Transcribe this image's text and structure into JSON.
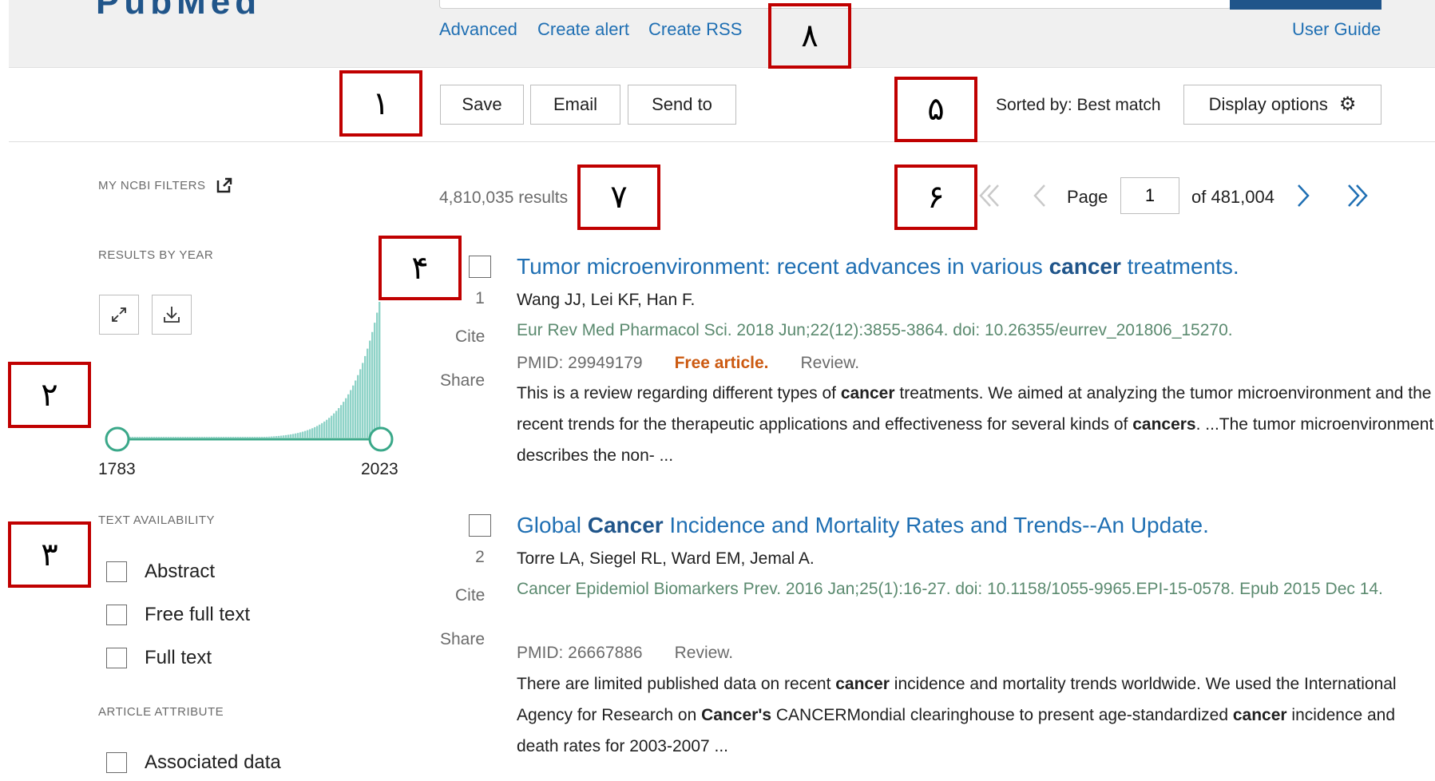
{
  "header": {
    "logo": "PubMed",
    "links": {
      "advanced": "Advanced",
      "create_alert": "Create alert",
      "create_rss": "Create RSS"
    },
    "user_guide": "User Guide"
  },
  "toolbar": {
    "save": "Save",
    "email": "Email",
    "send_to": "Send to",
    "sorted_by": "Sorted by: Best match",
    "display_options": "Display options"
  },
  "sidebar": {
    "my_ncbi_filters": "MY NCBI FILTERS",
    "results_by_year": "RESULTS BY YEAR",
    "year_start": "1783",
    "year_end": "2023",
    "text_availability": "TEXT AVAILABILITY",
    "text_filters": [
      "Abstract",
      "Free full text",
      "Full text"
    ],
    "article_attribute": "ARTICLE ATTRIBUTE",
    "attribute_filters": [
      "Associated data"
    ]
  },
  "histogram": {
    "color": "#8fd3c8",
    "slider_color": "#3aa889",
    "start_year": 1783,
    "end_year": 2023
  },
  "results_bar": {
    "count": "4,810,035 results",
    "page_label": "Page",
    "page_value": "1",
    "of_pages": "of 481,004"
  },
  "results": [
    {
      "number": "1",
      "cite": "Cite",
      "share": "Share",
      "title_parts": [
        "Tumor microenvironment: recent advances in various ",
        "cancer",
        " treatments."
      ],
      "authors": "Wang JJ, Lei KF, Han F.",
      "citation": "Eur Rev Med Pharmacol Sci. 2018 Jun;22(12):3855-3864. doi: 10.26355/eurrev_201806_15270.",
      "pmid": "PMID: 29949179",
      "free": "Free article.",
      "type": "Review.",
      "snippet_parts": [
        "This is a review regarding different types of ",
        "cancer",
        " treatments. We aimed at analyzing the tumor microenvironment and the recent trends for the therapeutic applications and effectiveness for several kinds of ",
        "cancers",
        ". ...The tumor microenvironment describes the non- ..."
      ]
    },
    {
      "number": "2",
      "cite": "Cite",
      "share": "Share",
      "title_parts": [
        "Global ",
        "Cancer",
        " Incidence and Mortality Rates and Trends--An Update."
      ],
      "authors": "Torre LA, Siegel RL, Ward EM, Jemal A.",
      "citation": "Cancer Epidemiol Biomarkers Prev. 2016 Jan;25(1):16-27. doi: 10.1158/1055-9965.EPI-15-0578. Epub 2015 Dec 14.",
      "pmid": "PMID: 26667886",
      "type": "Review.",
      "snippet_parts": [
        "There are limited published data on recent ",
        "cancer",
        " incidence and mortality trends worldwide. We used the International Agency for Research on ",
        "Cancer's",
        " CANCERMondial clearinghouse to present age-standardized ",
        "cancer",
        " incidence and death rates for 2003-2007 ..."
      ]
    }
  ],
  "annotations": {
    "m1": "١",
    "m2": "٢",
    "m3": "٣",
    "m4": "۴",
    "m5": "۵",
    "m6": "۶",
    "m7": "٧",
    "m8": "٨"
  }
}
